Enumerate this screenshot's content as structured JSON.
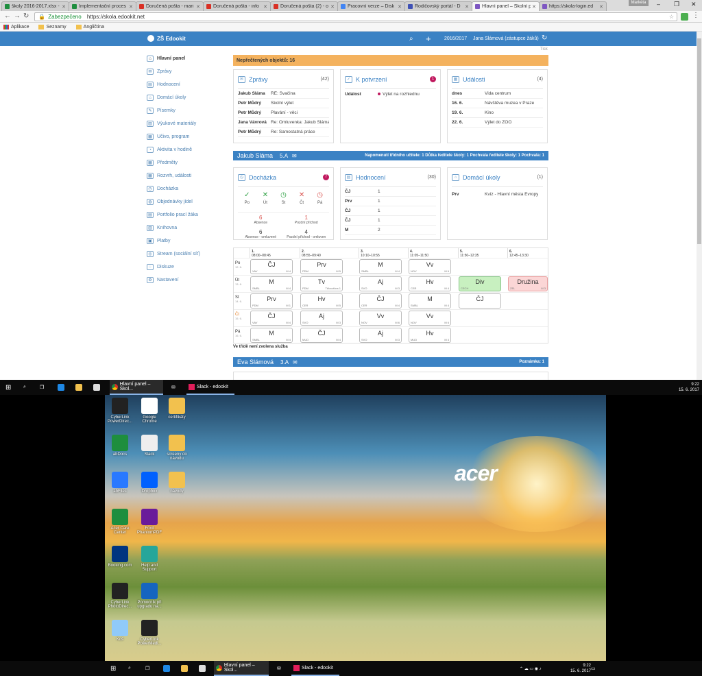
{
  "browser": {
    "tabs": [
      {
        "label": "školy 2016-2017.xlsx -",
        "color": "#1e8e3e"
      },
      {
        "label": "Implementační proces",
        "color": "#1e8e3e"
      },
      {
        "label": "Doručená pošta - mari",
        "color": "#d93025"
      },
      {
        "label": "Doručená pošta - info",
        "color": "#d93025"
      },
      {
        "label": "Doručená pošta (2) - o",
        "color": "#d93025"
      },
      {
        "label": "Pracovní verze – Disk",
        "color": "#4285f4"
      },
      {
        "label": "Rodičovský portál - D",
        "color": "#3f51b5"
      },
      {
        "label": "Hlavní panel – Školní p",
        "color": "#7e57c2"
      },
      {
        "label": "https://skola-login.ed",
        "color": "#7e57c2"
      }
    ],
    "user_badge": "Markéta",
    "secure_label": "Zabezpečeno",
    "url": "https://skola.edookit.net",
    "bookmarks": [
      "Aplikace",
      "Seznamy",
      "Angličtina"
    ]
  },
  "app": {
    "logo": "ZŠ Edookit",
    "year": "2016/2017",
    "user": "Jana Slámová (zástupce žáků)",
    "print": "Tisk",
    "sidebar": [
      "Hlavní panel",
      "Zprávy",
      "Hodnocení",
      "Domácí úkoly",
      "Písemky",
      "Výukové materiály",
      "Učivo, program",
      "Aktivita v hodině",
      "Předměty",
      "Rozvrh, události",
      "Docházka",
      "Objednávky jídel",
      "Portfolio prací žáka",
      "Knihovna",
      "Platby",
      "Stream (sociální síť)",
      "Diskuze",
      "Nastavení"
    ],
    "unread": "Nepřečtených objektů: 16",
    "messages": {
      "title": "Zprávy",
      "count": "(42)",
      "rows": [
        {
          "from": "Jakub Sláma",
          "text": "RE: Svačina"
        },
        {
          "from": "Petr Můdrý",
          "text": "Školní výlet"
        },
        {
          "from": "Petr Můdrý",
          "text": "Plavání - věci"
        },
        {
          "from": "Jana Vávrová",
          "text": "Re: Omluvenka: Jakub Sláma"
        },
        {
          "from": "Petr Můdrý",
          "text": "Re: Samostatná práce"
        }
      ]
    },
    "confirm": {
      "title": "K potvrzení",
      "badge": "1",
      "rows": [
        {
          "k": "Událost",
          "v": "Výlet na rozhlednu"
        }
      ]
    },
    "events": {
      "title": "Události",
      "count": "(4)",
      "rows": [
        {
          "k": "dnes",
          "v": "Vida centrum"
        },
        {
          "k": "16. 6.",
          "v": "Návštěva muzea v Praze"
        },
        {
          "k": "19. 6.",
          "v": "Kino"
        },
        {
          "k": "22. 6.",
          "v": "Výlet do ZOO"
        }
      ]
    },
    "student1": {
      "name": "Jakub Sláma",
      "class": "5.A",
      "note": "Napomenutí třídního učitele: 1 Důtka ředitele školy: 1 Pochvala ředitele školy: 1 Pochvala: 1"
    },
    "attendance": {
      "title": "Docházka",
      "badge": "7",
      "days": [
        {
          "mark": "✓",
          "label": "Po",
          "color": "#2ea043"
        },
        {
          "mark": "✕",
          "label": "Út",
          "color": "#2ea043"
        },
        {
          "mark": "◷",
          "label": "St",
          "color": "#2ea043"
        },
        {
          "mark": "✕",
          "label": "Čt",
          "color": "#d9534f"
        },
        {
          "mark": "◷",
          "label": "Pá",
          "color": "#d9534f"
        }
      ],
      "stats": [
        {
          "num": "6",
          "label": "Absence",
          "color": "#d9534f"
        },
        {
          "num": "1",
          "label": "Pozdní příchod",
          "color": "#d9534f"
        },
        {
          "num": "6",
          "label": "Absence - omluvené",
          "color": "#333"
        },
        {
          "num": "4",
          "label": "Pozdní příchod - omluven",
          "color": "#333"
        }
      ]
    },
    "grades": {
      "title": "Hodnocení",
      "count": "(30)",
      "rows": [
        {
          "k": "ČJ",
          "v": "1"
        },
        {
          "k": "Prv",
          "v": "1"
        },
        {
          "k": "ČJ",
          "v": "1"
        },
        {
          "k": "ČJ",
          "v": "1"
        },
        {
          "k": "M",
          "v": "2"
        }
      ]
    },
    "homework": {
      "title": "Domácí úkoly",
      "count": "(1)",
      "rows": [
        {
          "k": "Prv",
          "v": "Kvíz - Hlavní města Evropy"
        }
      ]
    },
    "timetable": {
      "periods": [
        {
          "n": "1.",
          "t": "08:00–08:45"
        },
        {
          "n": "2.",
          "t": "08:55–09:40"
        },
        {
          "n": "3.",
          "t": "10:10–10:55"
        },
        {
          "n": "4.",
          "t": "11:05–11:50"
        },
        {
          "n": "5.",
          "t": "11:50–12:35"
        },
        {
          "n": "6.",
          "t": "12:45–13:30"
        }
      ],
      "days": [
        {
          "d": "Po",
          "date": "12. 6."
        },
        {
          "d": "Út",
          "date": "13. 6."
        },
        {
          "d": "St",
          "date": "14. 6."
        },
        {
          "d": "Čt",
          "date": "15. 6."
        },
        {
          "d": "Pá",
          "date": "16. 6."
        }
      ],
      "no_service": "Ve třídě není zvolena služba"
    },
    "student2": {
      "name": "Eva Slámová",
      "class": "3.A",
      "note": "Poznámka: 1"
    }
  },
  "taskbar": {
    "apps": [
      "Hlavní panel – Škol...",
      "Slack - edookit"
    ],
    "time": "9:22",
    "date": "15. 6. 2017"
  },
  "desktop": {
    "brand": "acer",
    "icons": [
      "CyberLink PowerDirec...",
      "Google Chrome",
      "certifikáty",
      "abDocs",
      "Slack",
      "screeny do návodu",
      "abFiles",
      "Dropbox",
      "návody",
      "Acer Care Center",
      "Foxit PhantomPDF",
      "Booking.com",
      "Help and Support",
      "CyberLink PhotoDirec...",
      "Pomocník při upgradu na...",
      "Koš",
      "CyberLink PowerMedi..."
    ]
  }
}
